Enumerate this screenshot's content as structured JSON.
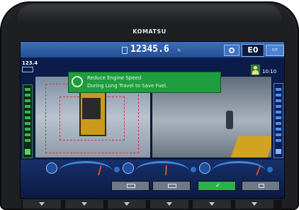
{
  "brand": "KOMATSU",
  "header": {
    "service_meter": "12345.6",
    "service_meter_unit": "h",
    "mode": "E0",
    "small_button_label": "P/E"
  },
  "left_panel": {
    "value": "123.4"
  },
  "right_panel": {
    "clock": "10:10"
  },
  "message": {
    "line1": "Reduce Engine Speed",
    "line2": "During Long Travel to Save Fuel."
  },
  "gauges": [
    {
      "name": "engine-coolant-temperature-gauge",
      "icon": "coolant-icon",
      "level": 0.72
    },
    {
      "name": "hydraulic-oil-temperature-gauge",
      "icon": "oil-icon",
      "level": 0.55
    },
    {
      "name": "fuel-gauge",
      "icon": "fuel-icon",
      "level": 0.82
    }
  ],
  "function_buttons": [
    {
      "name": "camera-view-1-button",
      "icon": "camera-icon",
      "active": false
    },
    {
      "name": "camera-view-2-button",
      "icon": "camera-icon",
      "active": false
    },
    {
      "name": "confirm-button",
      "icon": "check-icon",
      "label": "✓",
      "active": true
    },
    {
      "name": "menu-button",
      "icon": "menu-icon",
      "active": false
    }
  ],
  "colors": {
    "screen_bg": "#0b1c4a",
    "header_blue": "#2b5aa2",
    "message_green": "#1f9d3f",
    "active_button": "#2fae4c",
    "inactive_button": "#6f7886"
  }
}
